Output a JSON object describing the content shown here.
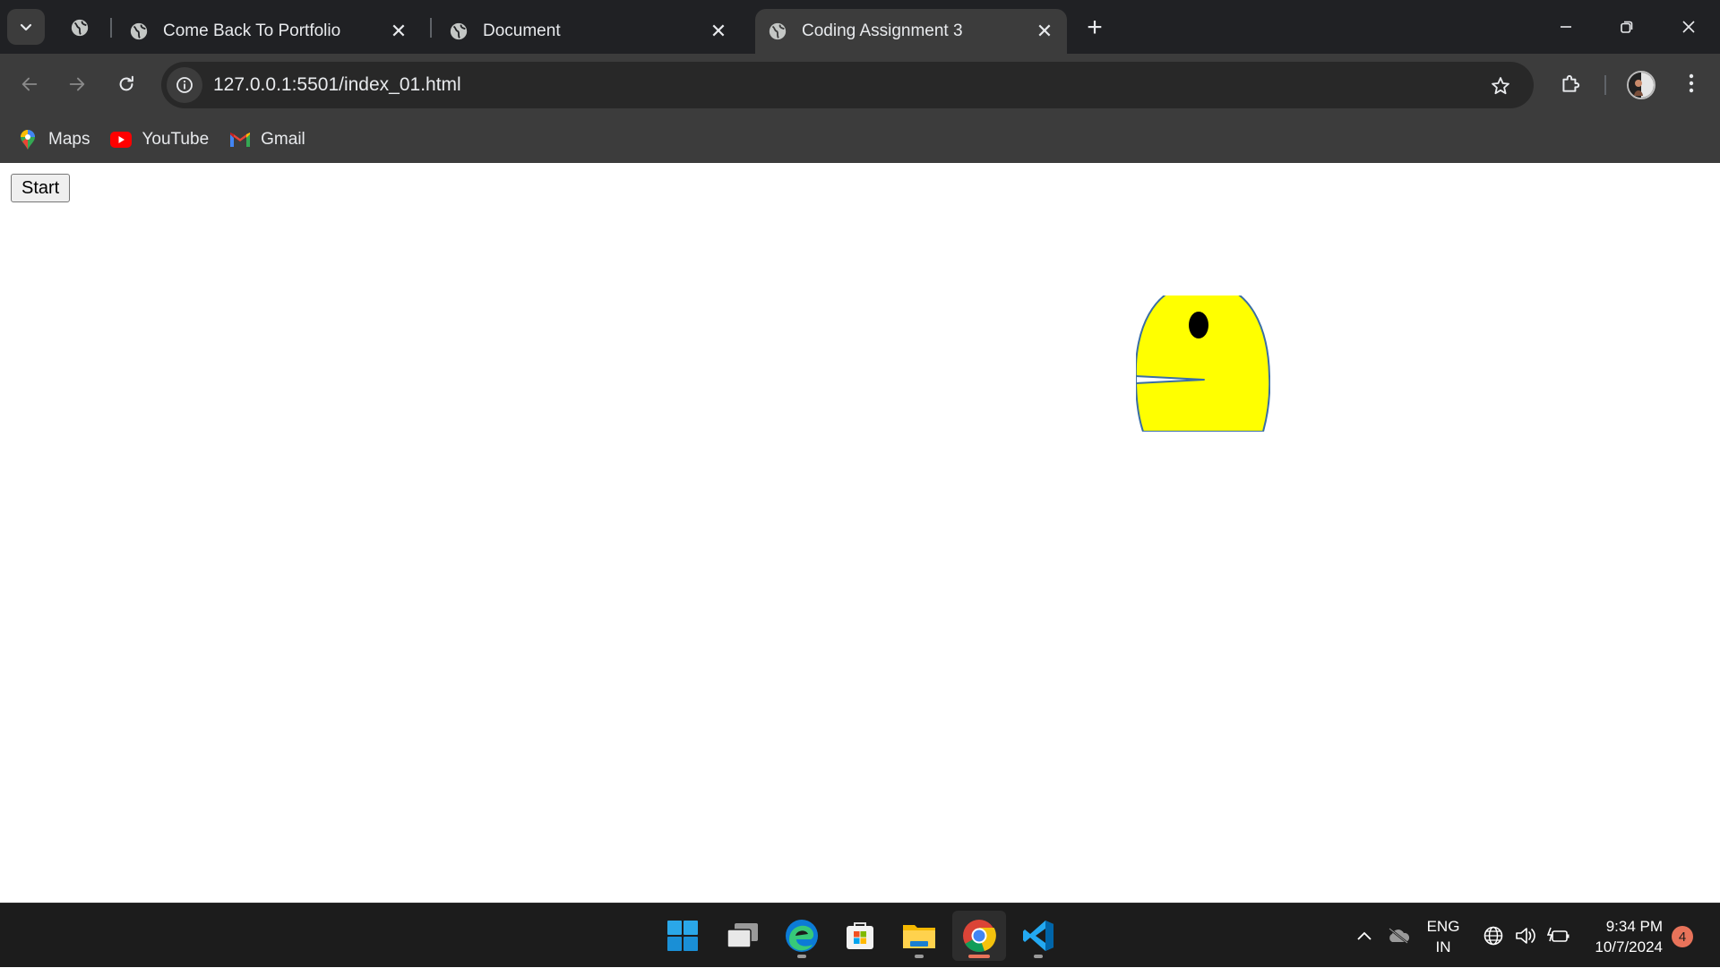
{
  "browser": {
    "tabs": [
      {
        "title": "Come Back To Portfolio",
        "icon": "globe-icon"
      },
      {
        "title": "Document",
        "icon": "globe-icon"
      },
      {
        "title": "Coding Assignment 3",
        "icon": "globe-icon",
        "active": true
      }
    ],
    "url": "127.0.0.1:5501/index_01.html",
    "bookmarks": [
      {
        "label": "Maps",
        "icon": "maps-pin-icon"
      },
      {
        "label": "YouTube",
        "icon": "youtube-icon"
      },
      {
        "label": "Gmail",
        "icon": "gmail-icon"
      }
    ],
    "colors": {
      "tabstrip": "#202124",
      "toolbar": "#3c3c3c",
      "omnibox": "#282828"
    }
  },
  "page": {
    "start_button": "Start",
    "pacman": {
      "fill": "#ffff00",
      "stroke": "#3a6ea5",
      "eye": "#000000"
    }
  },
  "taskbar": {
    "apps": [
      "windows-start-icon",
      "task-view-icon",
      "edge-icon",
      "microsoft-store-icon",
      "file-explorer-icon",
      "chrome-icon",
      "vscode-icon"
    ],
    "language_line1": "ENG",
    "language_line2": "IN",
    "time": "9:34 PM",
    "date": "10/7/2024",
    "notification_count": "4"
  }
}
